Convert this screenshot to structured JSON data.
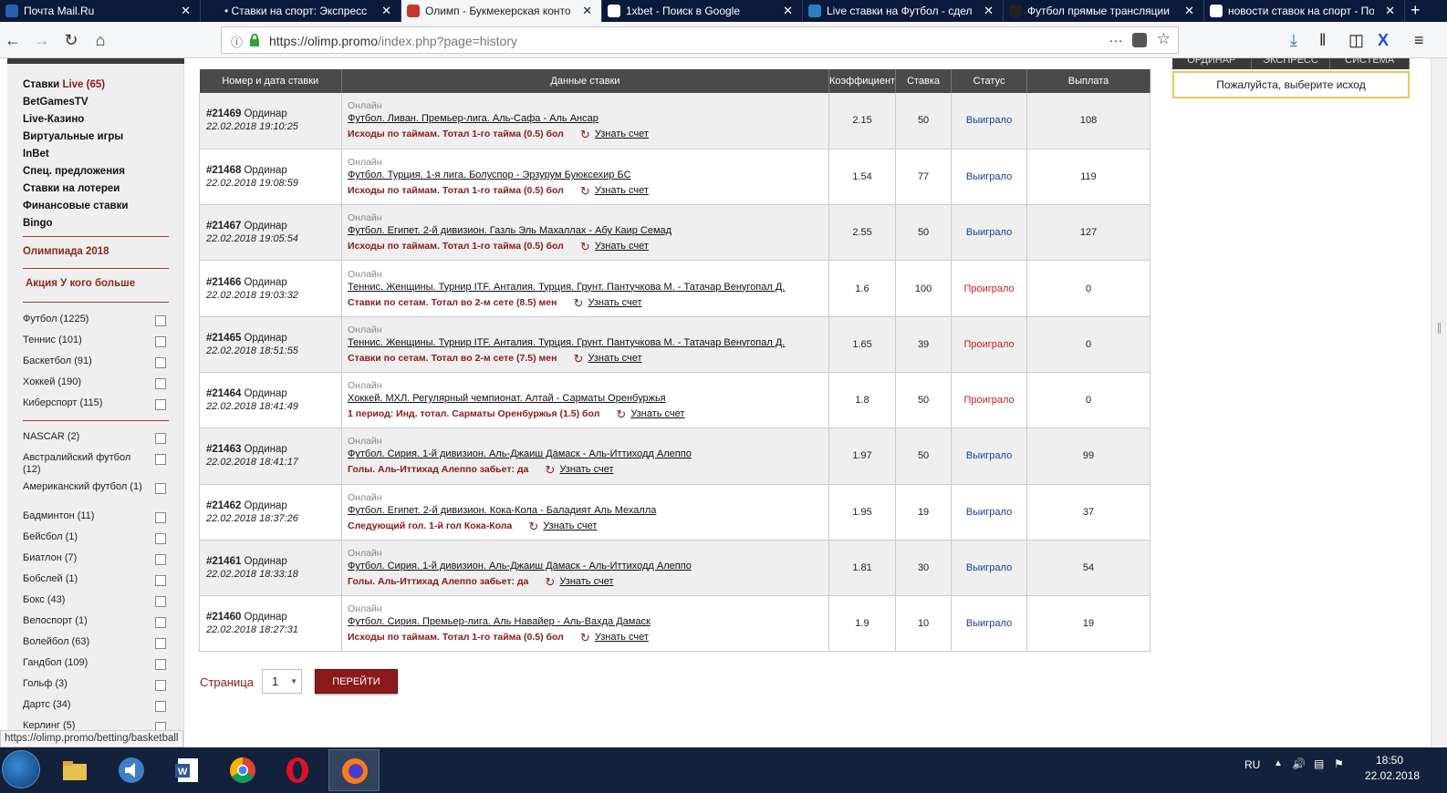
{
  "browser": {
    "tabs": [
      {
        "title": "Почта Mail.Ru",
        "favicon_color": "#2a5fb0"
      },
      {
        "title": "• Ставки на спорт: Экспресс , О",
        "favicon_color": "#0b1a3b"
      },
      {
        "title": "Олимп - Букмекерская конто",
        "favicon_color": "#c0392b"
      },
      {
        "title": "1xbet - Поиск в Google",
        "favicon_color": "#ffffff"
      },
      {
        "title": "Live ставки на Футбол - сдела",
        "favicon_color": "#2a7fc0"
      },
      {
        "title": "Футбол прямые трансляции -",
        "favicon_color": "#222222"
      },
      {
        "title": "новости ставок на спорт - По",
        "favicon_color": "#ffffff"
      }
    ],
    "url_host": "https://olimp.promo",
    "url_path": "/index.php?page=history",
    "status_url": "https://olimp.promo/betting/basketball"
  },
  "sidebar": {
    "menu": [
      {
        "label": "Ставки ",
        "live": "Live (65)"
      },
      {
        "label": "BetGamesTV"
      },
      {
        "label": "Live-Казино"
      },
      {
        "label": "Виртуальные игры"
      },
      {
        "label": "InBet"
      },
      {
        "label": "Спец. предложения"
      },
      {
        "label": "Ставки на лотереи"
      },
      {
        "label": "Финансовые ставки"
      },
      {
        "label": "Bingo"
      }
    ],
    "promo1": "Олимпиада 2018",
    "promo2": "Акция У кого больше",
    "sports_top": [
      "Футбол (1225)",
      "Теннис (101)",
      "Баскетбол (91)",
      "Хоккей (190)",
      "Киберспорт (115)"
    ],
    "sports_more": [
      "NASCAR (2)",
      "Австралийский футбол (12)",
      "Американский футбол (1)",
      "Бадминтон (11)",
      "Бейсбол (1)",
      "Биатлон (7)",
      "Бобслей (1)",
      "Бокс (43)",
      "Велоспорт (1)",
      "Волейбол (63)",
      "Гандбол (109)",
      "Гольф (3)",
      "Дартс (34)",
      "Керлинг (5)"
    ]
  },
  "table": {
    "headers": [
      "Номер и дата ставки",
      "Данные ставки",
      "Коэффициент",
      "Ставка",
      "Статус",
      "Выплата"
    ],
    "online_label": "Онлайн",
    "score_label": "Узнать счет",
    "rows": [
      {
        "num": "#21469",
        "type": "Ординар",
        "date": "22.02.2018 19:10:25",
        "event": "Футбол. Ливан. Премьер-лига. Аль-Сафа - Аль Ансар",
        "outcome": "Исходы по таймам. Тотал 1-го тайма (0.5) бол",
        "coef": "2.15",
        "stake": "50",
        "status": "Выиграло",
        "won": true,
        "payout": "108"
      },
      {
        "num": "#21468",
        "type": "Ординар",
        "date": "22.02.2018 19:08:59",
        "event": "Футбол. Турция. 1-я лига. Болуспор - Эрзурум Буюксехир БС",
        "outcome": "Исходы по таймам. Тотал 1-го тайма (0.5) бол",
        "coef": "1.54",
        "stake": "77",
        "status": "Выиграло",
        "won": true,
        "payout": "119"
      },
      {
        "num": "#21467",
        "type": "Ординар",
        "date": "22.02.2018 19:05:54",
        "event": "Футбол. Египет. 2-й дивизион. Газль Эль Махаллах - Абу Каир Семад",
        "outcome": "Исходы по таймам. Тотал 1-го тайма (0.5) бол",
        "coef": "2.55",
        "stake": "50",
        "status": "Выиграло",
        "won": true,
        "payout": "127"
      },
      {
        "num": "#21466",
        "type": "Ординар",
        "date": "22.02.2018 19:03:32",
        "event": "Теннис. Женщины. Турнир ITF. Анталия. Турция. Грунт. Пантучкова М. - Татачар Венугопал Д.",
        "outcome": "Ставки по сетам. Тотал во 2-м сете (8.5) мен",
        "coef": "1.6",
        "stake": "100",
        "status": "Проиграло",
        "won": false,
        "payout": "0"
      },
      {
        "num": "#21465",
        "type": "Ординар",
        "date": "22.02.2018 18:51:55",
        "event": "Теннис. Женщины. Турнир ITF. Анталия. Турция. Грунт. Пантучкова М. - Татачар Венугопал Д.",
        "outcome": "Ставки по сетам. Тотал во 2-м сете (7.5) мен",
        "coef": "1.65",
        "stake": "39",
        "status": "Проиграло",
        "won": false,
        "payout": "0"
      },
      {
        "num": "#21464",
        "type": "Ординар",
        "date": "22.02.2018 18:41:49",
        "event": "Хоккей. МХЛ. Регулярный чемпионат. Алтай - Сарматы Оренбуржья",
        "outcome": "1 период: Инд. тотал. Сарматы Оренбуржья (1.5) бол",
        "coef": "1.8",
        "stake": "50",
        "status": "Проиграло",
        "won": false,
        "payout": "0"
      },
      {
        "num": "#21463",
        "type": "Ординар",
        "date": "22.02.2018 18:41:17",
        "event": "Футбол. Сирия. 1-й дивизион. Аль-Джаиш Дамаск - Аль-Иттиходд Алеппо",
        "outcome": "Голы. Аль-Иттихад Алеппо забьет: да",
        "coef": "1.97",
        "stake": "50",
        "status": "Выиграло",
        "won": true,
        "payout": "99"
      },
      {
        "num": "#21462",
        "type": "Ординар",
        "date": "22.02.2018 18:37:26",
        "event": "Футбол. Египет. 2-й дивизион. Кока-Кола - Баладият Аль Мехалла",
        "outcome": "Следующий гол. 1-й гол Кока-Кола",
        "coef": "1.95",
        "stake": "19",
        "status": "Выиграло",
        "won": true,
        "payout": "37"
      },
      {
        "num": "#21461",
        "type": "Ординар",
        "date": "22.02.2018 18:33:18",
        "event": "Футбол. Сирия. 1-й дивизион. Аль-Джаиш Дамаск - Аль-Иттиходд Алеппо",
        "outcome": "Голы. Аль-Иттихад Алеппо забьет: да",
        "coef": "1.81",
        "stake": "30",
        "status": "Выиграло",
        "won": true,
        "payout": "54"
      },
      {
        "num": "#21460",
        "type": "Ординар",
        "date": "22.02.2018 18:27:31",
        "event": "Футбол. Сирия. Премьер-лига. Аль Навайер - Аль-Вахда Дамаск",
        "outcome": "Исходы по таймам. Тотал 1-го тайма (0.5) бол",
        "coef": "1.9",
        "stake": "10",
        "status": "Выиграло",
        "won": true,
        "payout": "19"
      }
    ]
  },
  "pager": {
    "label": "Страница",
    "value": "1",
    "go": "ПЕРЕЙТИ"
  },
  "right_panel": {
    "tabs": [
      "ОРДИНАР",
      "ЭКСПРЕСС",
      "СИСТЕМА"
    ],
    "message": "Пожалуйста, выберите исход"
  },
  "taskbar": {
    "lang": "RU",
    "time": "18:50",
    "date": "22.02.2018"
  },
  "colors": {
    "accent": "#8b1a1a",
    "won": "#1a3fa6",
    "lost": "#c62020",
    "header": "#4a4a4a"
  }
}
